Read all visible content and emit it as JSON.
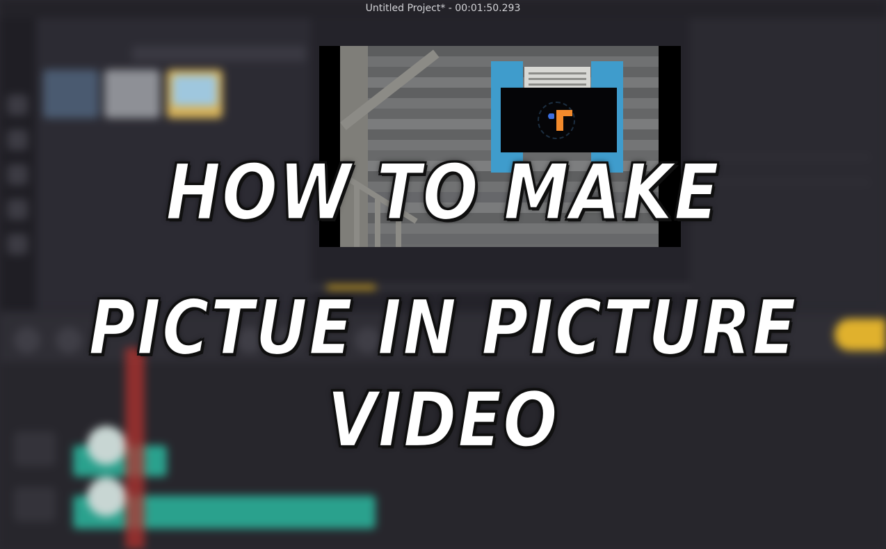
{
  "window": {
    "title": "Untitled Project* - 00:01:50.293"
  },
  "preview": {
    "pip_logo": "app-logo-icon"
  },
  "overlay": {
    "headline_line1": "HOW TO MAKE",
    "headline_line2": "PICTUE IN PICTURE VIDEO"
  },
  "colors": {
    "accent": "#e6b526",
    "clip": "#2aa18d",
    "playhead": "#b3332f",
    "shutter": "#3f9ccc",
    "background": "#2a2930"
  }
}
